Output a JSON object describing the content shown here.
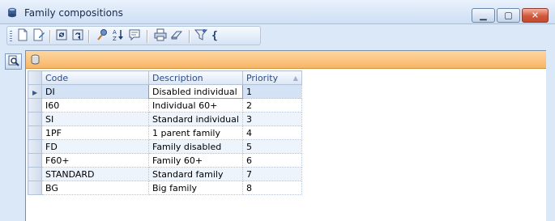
{
  "window": {
    "title": "Family compositions",
    "controls": {
      "minimize_icon": "minimize-icon",
      "maximize_icon": "maximize-icon",
      "close_icon": "close-icon"
    }
  },
  "toolbar": {
    "buttons": [
      {
        "icon": "new-document-icon"
      },
      {
        "icon": "edit-document-icon"
      },
      {
        "icon": "refresh-icon"
      },
      {
        "icon": "refresh-all-icon"
      },
      {
        "icon": "pin-icon"
      },
      {
        "icon": "sort-az-icon"
      },
      {
        "icon": "comment-icon"
      },
      {
        "icon": "print-icon"
      },
      {
        "icon": "eraser-icon"
      },
      {
        "icon": "filter-icon"
      },
      {
        "icon": "bracket-icon"
      }
    ]
  },
  "grid": {
    "columns": [
      "Code",
      "Description",
      "Priority"
    ],
    "rows": [
      {
        "code": "DI",
        "description": "Disabled individual",
        "priority": "1"
      },
      {
        "code": "I60",
        "description": "Individual 60+",
        "priority": "2"
      },
      {
        "code": "SI",
        "description": "Standard individual",
        "priority": "3"
      },
      {
        "code": "1PF",
        "description": "1 parent family",
        "priority": "4"
      },
      {
        "code": "FD",
        "description": "Family disabled",
        "priority": "5"
      },
      {
        "code": "F60+",
        "description": "Family 60+",
        "priority": "6"
      },
      {
        "code": "STANDARD",
        "description": "Standard family",
        "priority": "7"
      },
      {
        "code": "BG",
        "description": "Big family",
        "priority": "8"
      }
    ]
  },
  "colors": {
    "accent_orange": "#f7b566",
    "selection": "#c3d4ef",
    "header_text": "#2a4c8a"
  }
}
